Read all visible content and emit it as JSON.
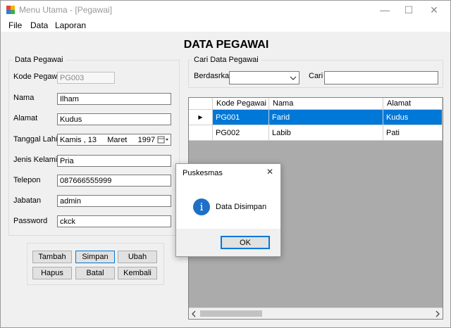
{
  "window": {
    "title": "Menu Utama - [Pegawai]",
    "minimize": "—",
    "maximize": "☐",
    "close": "✕"
  },
  "menu": [
    "File",
    "Data",
    "Laporan"
  ],
  "page_title": "DATA PEGAWAI",
  "form": {
    "group_title": "Data Pegawai",
    "kode_label": "Kode Pegawai",
    "kode_value": "PG003",
    "nama_label": "Nama",
    "nama_value": "Ilham",
    "alamat_label": "Alamat",
    "alamat_value": "Kudus",
    "tgl_label": "Tanggal Lahir",
    "tgl_value": "Kamis , 13     Maret     1997",
    "jk_label": "Jenis Kelamin",
    "jk_value": "Pria",
    "telp_label": "Telepon",
    "telp_value": "087666555999",
    "jabatan_label": "Jabatan",
    "jabatan_value": "admin",
    "password_label": "Password",
    "password_value": "ckck"
  },
  "buttons": {
    "tambah": "Tambah",
    "simpan": "Simpan",
    "ubah": "Ubah",
    "hapus": "Hapus",
    "batal": "Batal",
    "kembali": "Kembali"
  },
  "search": {
    "group_title": "Cari Data Pegawai",
    "berdasarkan_label": "Berdasrkan",
    "berdasarkan_value": "",
    "cari_label": "Cari",
    "cari_value": ""
  },
  "grid": {
    "columns": [
      "Kode Pegawai",
      "Nama",
      "Alamat"
    ],
    "rows": [
      {
        "kode": "PG001",
        "nama": "Farid",
        "alamat": "Kudus"
      },
      {
        "kode": "PG002",
        "nama": "Labib",
        "alamat": "Pati"
      }
    ],
    "selected_row_marker": "▶"
  },
  "dialog": {
    "title": "Puskesmas",
    "message": "Data Disimpan",
    "ok": "OK",
    "icon": "info-icon",
    "close": "✕"
  },
  "colors": {
    "selection": "#0078d7",
    "grid_background": "#ababab",
    "info_icon": "#1e6fc8"
  }
}
